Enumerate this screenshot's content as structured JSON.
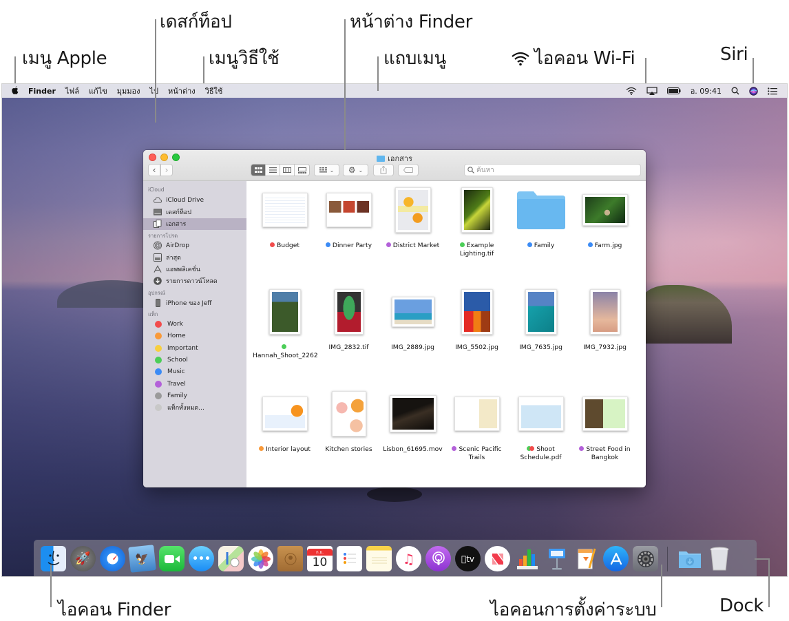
{
  "callouts": {
    "apple_menu": "เมนู Apple",
    "desktop": "เดสก์ท็อป",
    "help_menu": "เมนูวิธีใช้",
    "finder_window": "หน้าต่าง Finder",
    "menu_bar": "แถบเมนู",
    "wifi_icon": "ไอคอน Wi-Fi",
    "siri": "Siri",
    "finder_icon": "ไอคอน Finder",
    "system_prefs_icon": "ไอคอนการตั้งค่าระบบ",
    "dock": "Dock"
  },
  "menubar": {
    "apple": "",
    "app_name": "Finder",
    "items": [
      "ไฟล์",
      "แก้ไข",
      "มุมมอง",
      "ไป",
      "หน้าต่าง",
      "วิธีใช้"
    ],
    "clock": "อ. 09:41",
    "status_icons": [
      "wifi-icon",
      "airplay-icon",
      "battery-icon",
      "spotlight-icon",
      "siri-icon",
      "notification-center-icon"
    ]
  },
  "finder": {
    "title": "เอกสาร",
    "search_placeholder": "ค้นหา",
    "view_modes": [
      "icon",
      "list",
      "column",
      "gallery"
    ],
    "active_view": "icon",
    "sidebar": {
      "sections": [
        {
          "title": "iCloud",
          "items": [
            {
              "label": "iCloud Drive",
              "icon": "cloud-icon"
            },
            {
              "label": "เดสก์ท็อป",
              "icon": "desktop-icon"
            },
            {
              "label": "เอกสาร",
              "icon": "documents-icon",
              "selected": true
            }
          ]
        },
        {
          "title": "รายการโปรด",
          "items": [
            {
              "label": "AirDrop",
              "icon": "airdrop-icon"
            },
            {
              "label": "ล่าสุด",
              "icon": "recents-icon"
            },
            {
              "label": "แอพพลิเคชั่น",
              "icon": "applications-icon"
            },
            {
              "label": "รายการดาวน์โหลด",
              "icon": "downloads-icon"
            }
          ]
        },
        {
          "title": "อุปกรณ์",
          "items": [
            {
              "label": "iPhone ของ Jeff",
              "icon": "iphone-icon"
            }
          ]
        },
        {
          "title": "แท็ก",
          "tags": [
            {
              "label": "Work",
              "color": "#f24c4c"
            },
            {
              "label": "Home",
              "color": "#f99a3a"
            },
            {
              "label": "Important",
              "color": "#f7cf3f"
            },
            {
              "label": "School",
              "color": "#4cce58"
            },
            {
              "label": "Music",
              "color": "#3b8bf5"
            },
            {
              "label": "Travel",
              "color": "#b361d9"
            },
            {
              "label": "Family",
              "color": "#9a9a9a"
            },
            {
              "label": "แท็กทั้งหมด...",
              "color": "#c8c8c8"
            }
          ]
        }
      ]
    },
    "files": [
      {
        "name": "Budget",
        "tags": [
          "#f24c4c"
        ],
        "kind": "spreadsheet"
      },
      {
        "name": "Dinner Party",
        "tags": [
          "#3b8bf5"
        ],
        "kind": "document"
      },
      {
        "name": "District Market",
        "tags": [
          "#b361d9"
        ],
        "kind": "poster"
      },
      {
        "name": "Example Lighting.tif",
        "tags": [
          "#4cce58"
        ],
        "kind": "photo-plant"
      },
      {
        "name": "Family",
        "tags": [
          "#3b8bf5"
        ],
        "kind": "folder"
      },
      {
        "name": "Farm.jpg",
        "tags": [
          "#3b8bf5"
        ],
        "kind": "photo-tree"
      },
      {
        "name": "Hannah_Shoot_2262",
        "tags": [
          "#4cce58"
        ],
        "kind": "photo-portrait"
      },
      {
        "name": "IMG_2832.tif",
        "tags": [],
        "kind": "photo-hat"
      },
      {
        "name": "IMG_2889.jpg",
        "tags": [],
        "kind": "photo-beach"
      },
      {
        "name": "IMG_5502.jpg",
        "tags": [],
        "kind": "photo-wall"
      },
      {
        "name": "IMG_7635.jpg",
        "tags": [],
        "kind": "photo-climb"
      },
      {
        "name": "IMG_7932.jpg",
        "tags": [],
        "kind": "photo-flowers"
      },
      {
        "name": "Interior layout",
        "tags": [
          "#f99a3a"
        ],
        "kind": "layout"
      },
      {
        "name": "Kitchen stories",
        "tags": [],
        "kind": "magazine"
      },
      {
        "name": "Lisbon_61695.mov",
        "tags": [],
        "kind": "video"
      },
      {
        "name": "Scenic Pacific Trails",
        "tags": [
          "#b361d9"
        ],
        "kind": "map-doc"
      },
      {
        "name": "Shoot Schedule.pdf",
        "tags": [
          "#4cce58",
          "#f24c4c"
        ],
        "kind": "pdf"
      },
      {
        "name": "Street Food in Bangkok",
        "tags": [
          "#b361d9"
        ],
        "kind": "book"
      }
    ]
  },
  "dock": {
    "apps": [
      {
        "name": "Finder",
        "icon": "finder-icon"
      },
      {
        "name": "Launchpad",
        "icon": "launchpad-icon"
      },
      {
        "name": "Safari",
        "icon": "safari-icon"
      },
      {
        "name": "Mail",
        "icon": "mail-icon"
      },
      {
        "name": "FaceTime",
        "icon": "facetime-icon"
      },
      {
        "name": "Messages",
        "icon": "messages-icon"
      },
      {
        "name": "Maps",
        "icon": "maps-icon"
      },
      {
        "name": "Photos",
        "icon": "photos-icon"
      },
      {
        "name": "Contacts",
        "icon": "contacts-icon"
      },
      {
        "name": "Calendar",
        "icon": "calendar-icon",
        "month": "ก.ย.",
        "day": "10"
      },
      {
        "name": "Reminders",
        "icon": "reminders-icon"
      },
      {
        "name": "Notes",
        "icon": "notes-icon"
      },
      {
        "name": "Music",
        "icon": "music-icon"
      },
      {
        "name": "Podcasts",
        "icon": "podcasts-icon"
      },
      {
        "name": "Apple TV",
        "icon": "tv-icon",
        "label": "tv"
      },
      {
        "name": "News",
        "icon": "news-icon"
      },
      {
        "name": "Numbers",
        "icon": "numbers-icon"
      },
      {
        "name": "Keynote",
        "icon": "keynote-icon"
      },
      {
        "name": "Pages",
        "icon": "pages-icon"
      },
      {
        "name": "App Store",
        "icon": "app-store-icon"
      },
      {
        "name": "System Preferences",
        "icon": "system-preferences-icon"
      }
    ],
    "others": [
      {
        "name": "Downloads",
        "icon": "downloads-folder-icon"
      },
      {
        "name": "Trash",
        "icon": "trash-icon"
      }
    ]
  }
}
